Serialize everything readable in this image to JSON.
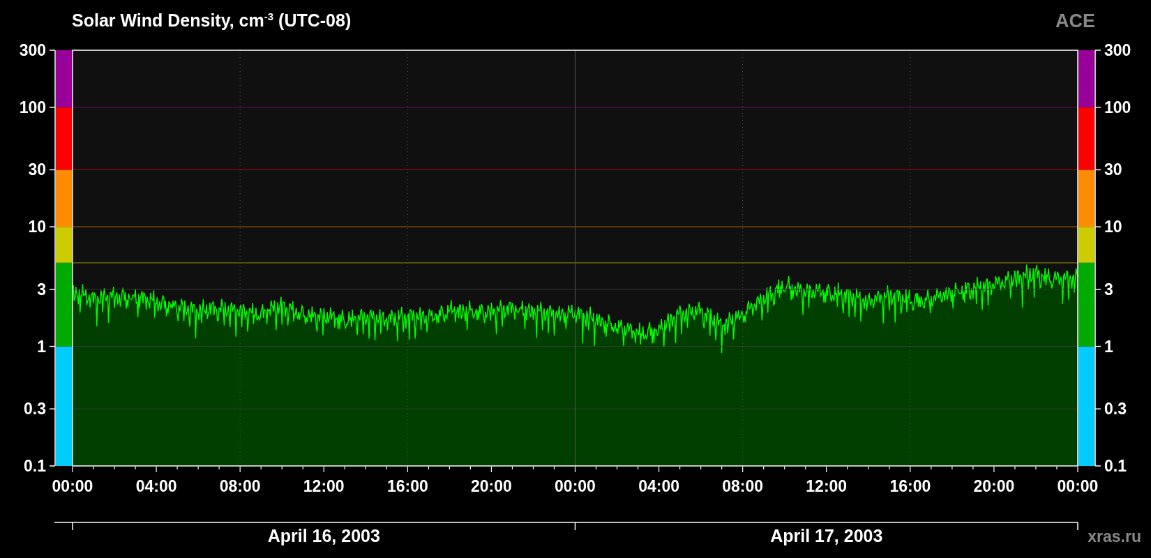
{
  "title": "Solar Wind Density, cm$^{-3}$ (UTC-08)",
  "source": "ACE",
  "scale_bands": [
    {
      "color": "#00ccff"
    },
    {
      "color": "#00aa00"
    },
    {
      "color": "#cccc00"
    },
    {
      "color": "#ff8c00"
    },
    {
      "color": "#ff0000"
    },
    {
      "color": "#990099"
    }
  ],
  "left_axis_labels": [
    "300",
    "100",
    "30",
    "10",
    "3",
    "1",
    "0.3",
    "0.1"
  ],
  "right_axis_labels": [
    "300",
    "100",
    "30",
    "10",
    "3",
    "1",
    "0.3",
    "0.1"
  ],
  "time_labels": [
    "00:00",
    "04:00",
    "08:00",
    "12:00",
    "16:00",
    "20:00",
    "00:00",
    "04:00",
    "08:00",
    "12:00",
    "16:00",
    "20:00",
    "00:00"
  ],
  "date_labels": [
    "April 16, 2003",
    "April 17, 2003"
  ],
  "credit": "xras.ru"
}
